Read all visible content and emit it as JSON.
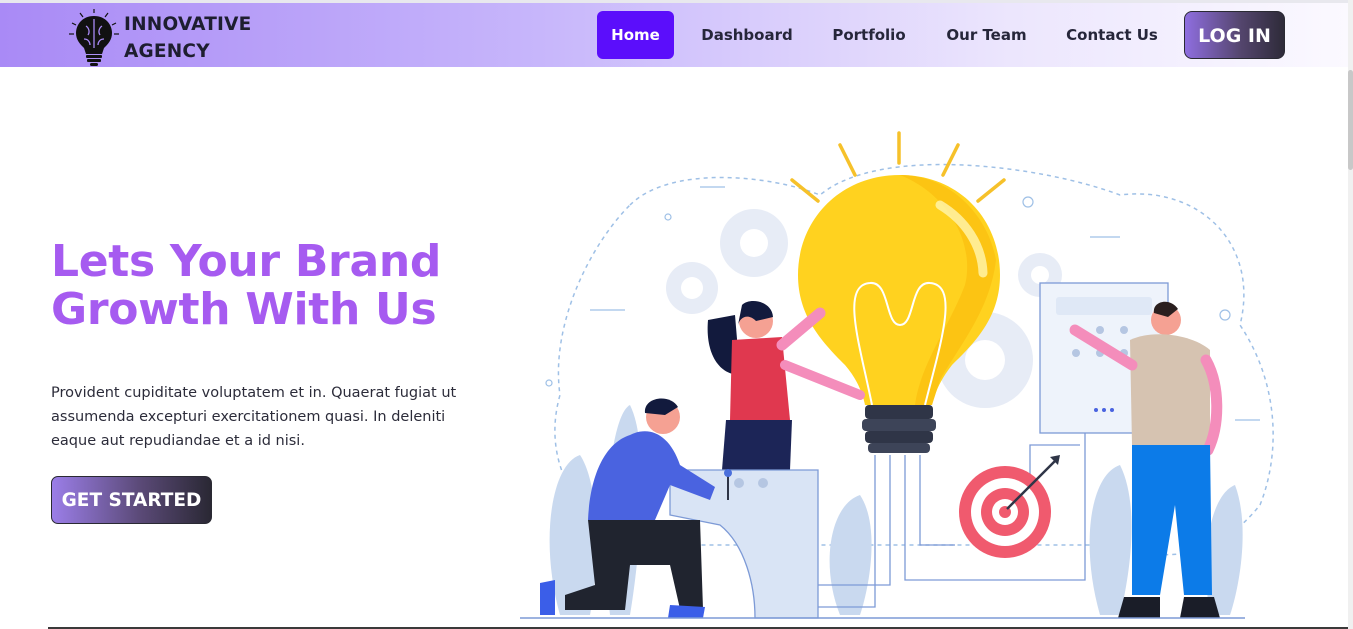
{
  "brand": {
    "line1": "INNOVATIVE",
    "line2": "AGENCY",
    "logo_icon": "brain-bulb-icon"
  },
  "nav": {
    "items": [
      {
        "label": "Home",
        "active": true
      },
      {
        "label": "Dashboard",
        "active": false
      },
      {
        "label": "Portfolio",
        "active": false
      },
      {
        "label": "Our Team",
        "active": false
      },
      {
        "label": "Contact Us",
        "active": false
      }
    ],
    "login_label": "LOG IN"
  },
  "hero": {
    "headline_line1": "Lets Your Brand",
    "headline_line2": "Growth With Us",
    "body": "Provident cupiditate voluptatem et in. Quaerat fugiat ut assumenda excepturi exercitationem quasi. In deleniti eaque aut repudiandae et a id nisi.",
    "cta_label": "GET STARTED"
  },
  "colors": {
    "accent": "#5b0efb",
    "headline": "#a65bf0",
    "bulb": "#ffd21f",
    "target": "#f05a6e"
  }
}
